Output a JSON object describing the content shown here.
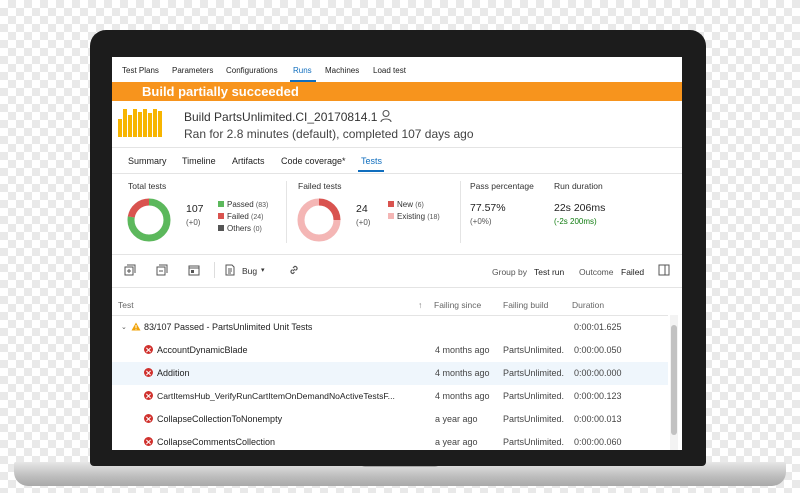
{
  "nav": {
    "tabs": [
      "Test Plans",
      "Parameters",
      "Configurations",
      "Runs",
      "Machines",
      "Load test"
    ],
    "active": "Runs"
  },
  "banner": {
    "text": "Build partially succeeded",
    "color": "#f7941d"
  },
  "build": {
    "title": "Build PartsUnlimited.CI_20170814.1",
    "subtitle": "Ran for 2.8 minutes (default), completed 107 days ago",
    "user_icon": "person-icon"
  },
  "subtabs": [
    "Summary",
    "Timeline",
    "Artifacts",
    "Code coverage*",
    "Tests"
  ],
  "stats": {
    "total": {
      "label": "Total tests",
      "value": "107",
      "delta": "(+0)",
      "legend": [
        {
          "label": "Passed",
          "count": "(83)",
          "color": "#5cb85c"
        },
        {
          "label": "Failed",
          "count": "(24)",
          "color": "#d9534f"
        },
        {
          "label": "Others",
          "count": "(0)",
          "color": "#555555"
        }
      ],
      "donut": [
        83,
        24,
        0
      ]
    },
    "failed": {
      "label": "Failed tests",
      "value": "24",
      "delta": "(+0)",
      "legend": [
        {
          "label": "New",
          "count": "(6)",
          "color": "#d9534f"
        },
        {
          "label": "Existing",
          "count": "(18)",
          "color": "#f4b6b5"
        }
      ],
      "donut": [
        6,
        18
      ]
    },
    "pass_percentage": {
      "label": "Pass percentage",
      "value": "77.57%",
      "delta": "(+0%)"
    },
    "run_duration": {
      "label": "Run duration",
      "value": "22s 206ms",
      "delta": "(-2s 200ms)"
    }
  },
  "toolbar": {
    "icons": [
      "expand-all-icon",
      "collapse-all-icon",
      "toggle-panel-icon",
      "bug-icon",
      "link-icon"
    ],
    "bug_label": "Bug",
    "group_by_label": "Group by",
    "group_by_value": "Test run",
    "outcome_label": "Outcome",
    "outcome_value": "Failed"
  },
  "table": {
    "columns": {
      "test": "Test",
      "failing_since": "Failing since",
      "failing_build": "Failing build",
      "duration": "Duration"
    },
    "group": {
      "label": "83/107 Passed - PartsUnlimited Unit Tests",
      "duration": "0:00:01.625"
    },
    "rows": [
      {
        "name": "AccountDynamicBlade",
        "failing_since": "4 months ago",
        "failing_build": "PartsUnlimited.",
        "duration": "0:00:00.050"
      },
      {
        "name": "Addition",
        "failing_since": "4 months ago",
        "failing_build": "PartsUnlimited.",
        "duration": "0:00:00.000"
      },
      {
        "name": "CartItemsHub_VerifyRunCartItemOnDemandNoActiveTestsF...",
        "failing_since": "4 months ago",
        "failing_build": "PartsUnlimited.",
        "duration": "0:00:00.123"
      },
      {
        "name": "CollapseCollectionToNonempty",
        "failing_since": "a year ago",
        "failing_build": "PartsUnlimited.",
        "duration": "0:00:00.013"
      },
      {
        "name": "CollapseCommentsCollection",
        "failing_since": "a year ago",
        "failing_build": "PartsUnlimited.",
        "duration": "0:00:00.060"
      }
    ]
  }
}
